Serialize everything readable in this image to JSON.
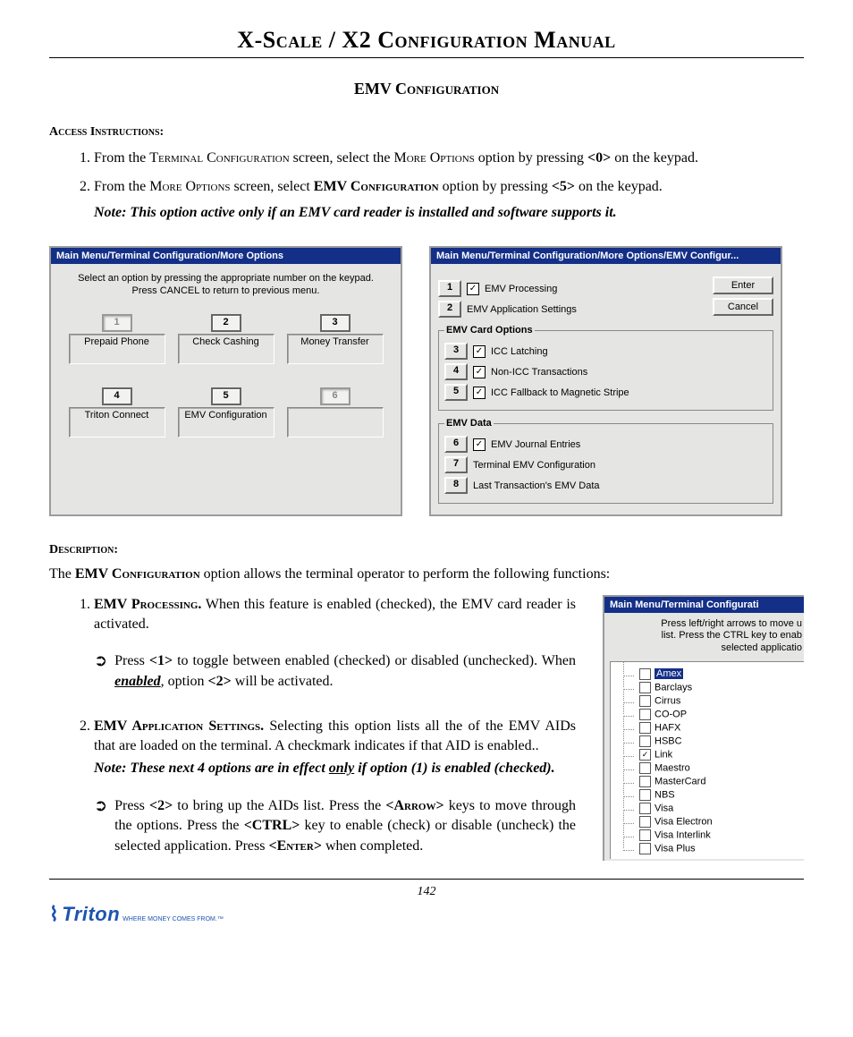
{
  "doc_title": "X-Scale / X2 Configuration Manual",
  "section_title": "EMV Configuration",
  "access_label": "Access Instructions:",
  "access_item1_a": "From the ",
  "access_item1_b": "Terminal Configuration",
  "access_item1_c": " screen, select the ",
  "access_item1_d": "More Options",
  "access_item1_e": " option by pressing ",
  "access_item1_f": "<0>",
  "access_item1_g": " on the keypad.",
  "access_item2_a": "From the ",
  "access_item2_b": "More Options",
  "access_item2_c": " screen, select ",
  "access_item2_d": "EMV Configuration",
  "access_item2_e": " option by pressing ",
  "access_item2_f": "<5>",
  "access_item2_g": " on the keypad.",
  "access_note": "Note: This option active only if an EMV card reader is installed and software supports it.",
  "shot1": {
    "title": "Main Menu/Terminal Configuration/More Options",
    "prompt1": "Select an option by pressing the appropriate number on the keypad.",
    "prompt2": "Press CANCEL to return to previous menu.",
    "keys": [
      "1",
      "2",
      "3",
      "4",
      "5",
      "6"
    ],
    "labels": [
      "Prepaid Phone",
      "Check Cashing",
      "Money Transfer",
      "Triton Connect",
      "EMV Configuration",
      ""
    ]
  },
  "shot2": {
    "title": "Main Menu/Terminal Configuration/More Options/EMV Configur...",
    "enter": "Enter",
    "cancel": "Cancel",
    "row1_key": "1",
    "row1_label": "EMV Processing",
    "row1_checked": "✓",
    "row2_key": "2",
    "row2_label": "EMV Application Settings",
    "card_legend": "EMV Card Options",
    "row3_key": "3",
    "row3_label": "ICC Latching",
    "row3_checked": "✓",
    "row4_key": "4",
    "row4_label": "Non-ICC Transactions",
    "row4_checked": "✓",
    "row5_key": "5",
    "row5_label": "ICC Fallback to Magnetic Stripe",
    "row5_checked": "✓",
    "data_legend": "EMV Data",
    "row6_key": "6",
    "row6_label": "EMV Journal Entries",
    "row6_checked": "✓",
    "row7_key": "7",
    "row7_label": "Terminal EMV Configuration",
    "row8_key": "8",
    "row8_label": "Last Transaction's EMV Data"
  },
  "desc_label": "Description:",
  "desc_lead_a": "The ",
  "desc_lead_b": "EMV Configuration",
  "desc_lead_c": " option allows the terminal operator to perform the following functions:",
  "f1_a": "EMV Processing.",
  "f1_b": "   When this feature is enabled (checked), the EMV card reader is activated.",
  "f1_arrow_a": "Press ",
  "f1_arrow_b": "<1>",
  "f1_arrow_c": " to toggle between enabled (checked) or disabled (unchecked).  When ",
  "f1_arrow_d": "enabled",
  "f1_arrow_e": ", option  ",
  "f1_arrow_f": "<2>",
  "f1_arrow_g": " will be activated.",
  "f2_a": "EMV Application Settings.",
  "f2_b": "  Selecting this option lists all the of the EMV AIDs that are loaded on the terminal.  A checkmark indicates if that AID is enabled..",
  "f2_note_a": "Note:  These next 4 options are in effect ",
  "f2_note_b": "only",
  "f2_note_c": " if option (1) is enabled (checked).",
  "f2_arrow_a": "Press ",
  "f2_arrow_b": "<2>",
  "f2_arrow_c": " to bring up the AIDs list. Press the ",
  "f2_arrow_d": "<Arrow>",
  "f2_arrow_e": " keys to move through the options.  Press the ",
  "f2_arrow_f": "<CTRL>",
  "f2_arrow_g": " key to enable (check) or disable (uncheck) the selected application. Press ",
  "f2_arrow_h": "<Enter>",
  "f2_arrow_i": " when completed.",
  "shot3": {
    "title": "Main Menu/Terminal Configurati",
    "prompt1": "Press left/right arrows to move u",
    "prompt2": "list.  Press the CTRL key to enab",
    "prompt3": "selected applicatio",
    "items": [
      "Amex",
      "Barclays",
      "Cirrus",
      "CO-OP",
      "HAFX",
      "HSBC",
      "Link",
      "Maestro",
      "MasterCard",
      "NBS",
      "Visa",
      "Visa Electron",
      "Visa Interlink",
      "Visa Plus"
    ],
    "checked_index": 6
  },
  "page_number": "142",
  "logo_text": "Triton",
  "logo_tag": "WHERE MONEY COMES FROM.™"
}
